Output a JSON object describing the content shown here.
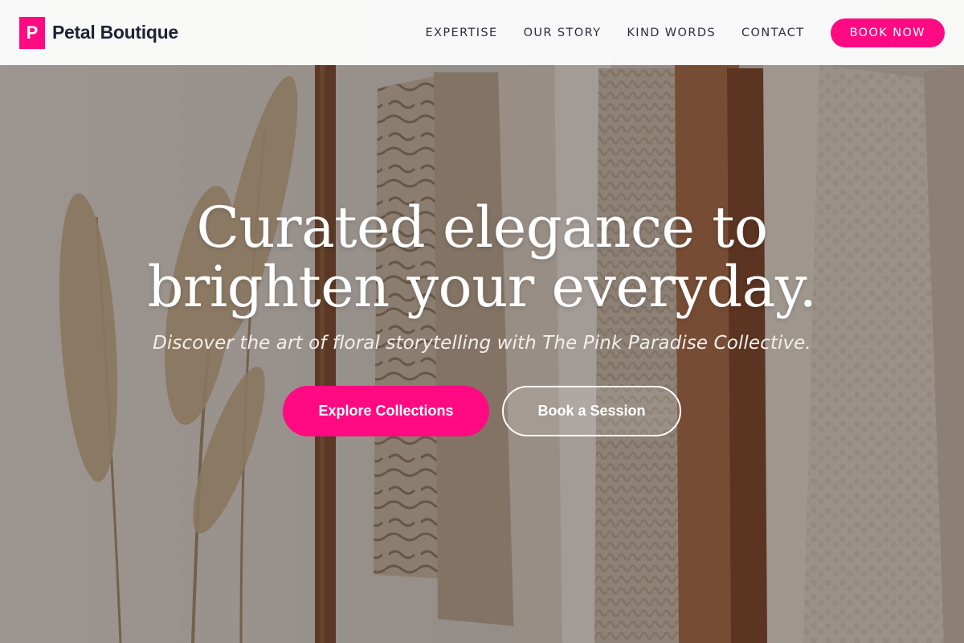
{
  "header": {
    "brand_mark": "P",
    "brand_name": "Petal Boutique",
    "nav": [
      {
        "label": "EXPERTISE"
      },
      {
        "label": "OUR STORY"
      },
      {
        "label": "KIND WORDS"
      },
      {
        "label": "CONTACT"
      }
    ],
    "cta_label": "BOOK NOW"
  },
  "hero": {
    "headline_line1": "Curated elegance to",
    "headline_line2": "brighten your everyday.",
    "subline": "Discover the art of floral storytelling with The Pink Paradise Collective.",
    "primary_cta": "Explore Collections",
    "secondary_cta": "Book a Session",
    "background_icon": "clothing-rack-photo"
  },
  "colors": {
    "accent": "#ff0a82",
    "text_dark": "#1f2233",
    "overlay": "rgba(40,30,25,0.38)"
  }
}
